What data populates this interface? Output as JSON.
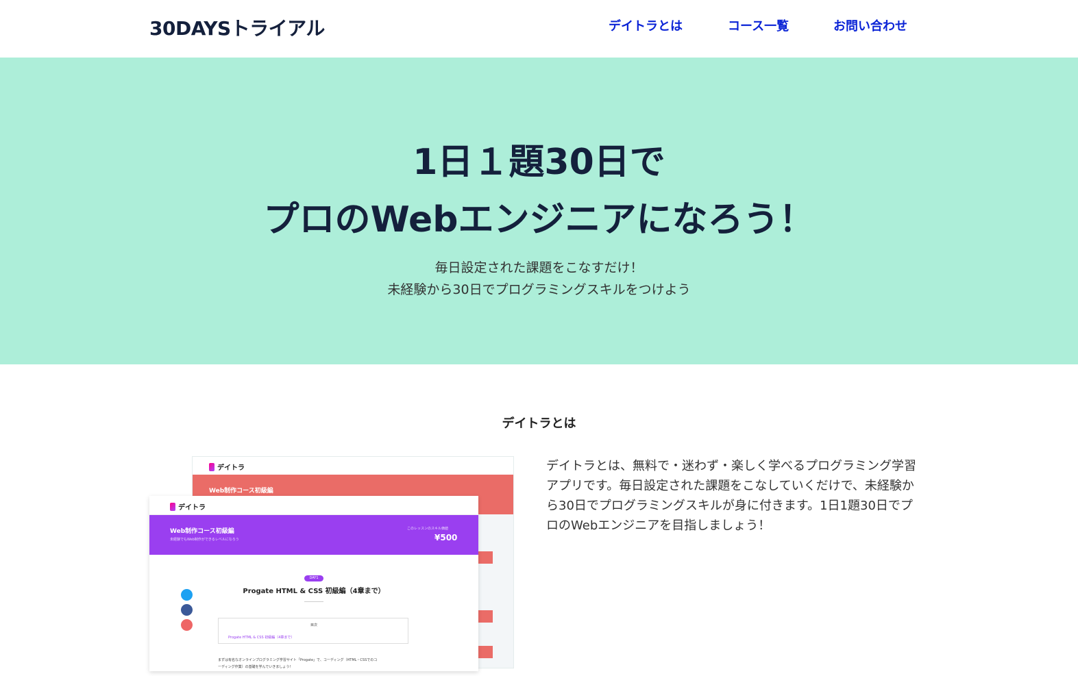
{
  "header": {
    "logo": "30DAYSトライアル",
    "nav": [
      "デイトラとは",
      "コース一覧",
      "お問い合わせ"
    ]
  },
  "hero": {
    "title_line1": "1日１題30日で",
    "title_line2": "プロのWebエンジニアになろう！",
    "subtitle_line1": "毎日設定された課題をこなすだけ！",
    "subtitle_line2": "未経験から30日でプログラミングスキルをつけよう",
    "background": "#adeed9"
  },
  "about": {
    "heading": "デイトラとは",
    "text": "デイトラとは、無料で・迷わず・楽しく学べるプログラミング学習アプリです。毎日設定された課題をこなしていくだけで、未経験から30日でプログラミングスキルが身に付きます。1日1題30日でプロのWebエンジニアを目指しましょう！"
  },
  "screenshot": {
    "back_logo": "デイトラ",
    "back_banner_title": "Web制作コース初級編",
    "front_logo": "デイトラ",
    "front_banner_title": "Web制作コース初級編",
    "front_banner_sub": "未経験でもWeb制作ができるレベルになろう",
    "front_banner_price_label": "このレッスンのスキル価値",
    "front_price": "¥500",
    "day_badge": "DAY1",
    "lesson_title": "Progate HTML & CSS 初級編（4章まで）",
    "toc_title": "目次",
    "toc_item": "Progate HTML & CSS 初級編（4章まで）",
    "body_line1": "まずは有名なオンラインプログラミング学習サイト「Progate」で、コーディング（HTML・CSSでのコ",
    "body_line2": "ーディング作業）の基礎を学んでいきましょう！"
  },
  "colors": {
    "nav_link": "#0a23d6",
    "title": "#14203c",
    "back_banner": "#ea6c67",
    "front_banner": "#9a3ff0"
  }
}
